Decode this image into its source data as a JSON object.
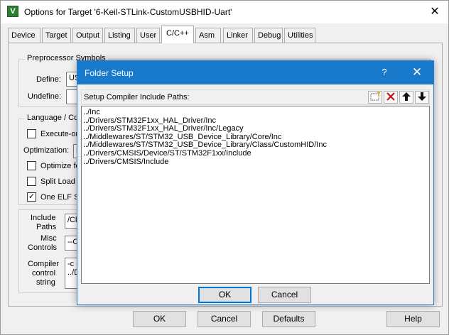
{
  "window": {
    "title": "Options for Target '6-Keil-STLink-CustomUSBHID-Uart'",
    "app_icon": "keil-uvision-icon",
    "close_glyph": "✕"
  },
  "tabs": [
    {
      "label": "Device"
    },
    {
      "label": "Target"
    },
    {
      "label": "Output"
    },
    {
      "label": "Listing"
    },
    {
      "label": "User"
    },
    {
      "label": "C/C++",
      "active": true
    },
    {
      "label": "Asm"
    },
    {
      "label": "Linker"
    },
    {
      "label": "Debug"
    },
    {
      "label": "Utilities"
    }
  ],
  "preprocessor": {
    "group_title": "Preprocessor Symbols",
    "define_label": "Define:",
    "define_value": "US",
    "undefine_label": "Undefine:"
  },
  "language": {
    "group_title": "Language / Co",
    "execute_only": {
      "label": "Execute-onl",
      "checked": false
    },
    "optimization_label": "Optimization:",
    "optimization_value": "L",
    "optimize_for": {
      "label": "Optimize for",
      "checked": false
    },
    "split_load": {
      "label": "Split Load a",
      "checked": false
    },
    "one_elf": {
      "label": "One ELF Se",
      "checked": true
    }
  },
  "include": {
    "paths_label_1": "Include",
    "paths_label_2": "Paths",
    "paths_value": "/Cla",
    "misc_label_1": "Misc",
    "misc_label_2": "Controls",
    "misc_value": "--CS",
    "compiler_label_1": "Compiler",
    "compiler_label_2": "control",
    "compiler_label_3": "string",
    "compiler_value_1": "-c --",
    "compiler_value_2": "../D"
  },
  "buttons": {
    "ok": "OK",
    "cancel": "Cancel",
    "defaults": "Defaults",
    "help": "Help"
  },
  "dialog": {
    "title": "Folder Setup",
    "help_glyph": "?",
    "close_glyph": "✕",
    "toolbar_label": "Setup Compiler Include Paths:",
    "toolbar_icons": [
      "new-folder-icon",
      "delete-icon",
      "move-up-icon",
      "move-down-icon"
    ],
    "paths": [
      "../Inc",
      "../Drivers/STM32F1xx_HAL_Driver/Inc",
      "../Drivers/STM32F1xx_HAL_Driver/Inc/Legacy",
      "../Middlewares/ST/STM32_USB_Device_Library/Core/Inc",
      "../Middlewares/ST/STM32_USB_Device_Library/Class/CustomHID/Inc",
      "../Drivers/CMSIS/Device/ST/STM32F1xx/Include",
      "../Drivers/CMSIS/Include"
    ],
    "ok": "OK",
    "cancel": "Cancel"
  }
}
